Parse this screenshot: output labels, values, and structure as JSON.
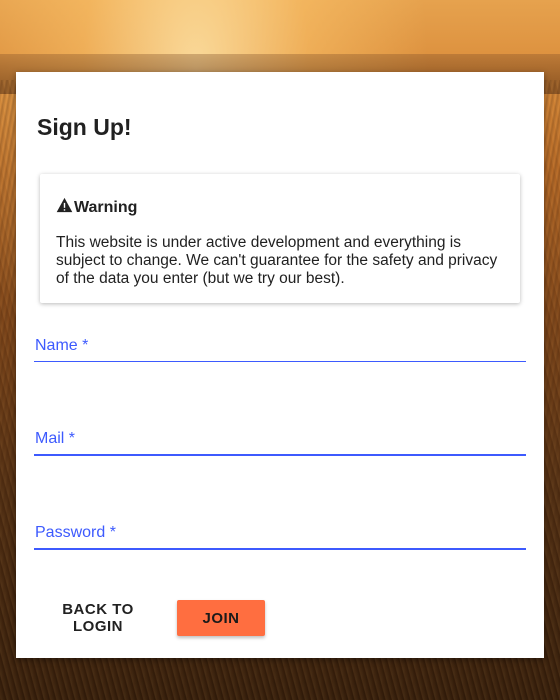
{
  "page": {
    "title": "Sign Up!"
  },
  "warning": {
    "icon": "warning-icon",
    "title": "Warning",
    "text": "This website is under active development and everything is subject to change. We can't guarantee for the safety and privacy of the data you enter (but we try our best)."
  },
  "form": {
    "name_label": "Name *",
    "name_value": "",
    "mail_label": "Mail *",
    "mail_value": "",
    "password_label": "Password *",
    "password_value": ""
  },
  "actions": {
    "back_label": "BACK TO LOGIN",
    "join_label": "JOIN"
  },
  "colors": {
    "accent": "#3d5afe",
    "primary_button": "#ff6e40",
    "card": "#ffffff",
    "text": "#212121"
  }
}
